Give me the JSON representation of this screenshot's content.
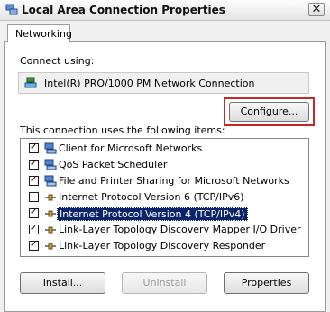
{
  "window": {
    "title": "Local Area Connection Properties",
    "close_glyph": "✕",
    "title_icon": "network-adapter-icon"
  },
  "tabs": [
    {
      "label": "Networking",
      "selected": true
    }
  ],
  "connect_using": {
    "label": "Connect using:",
    "adapter": "Intel(R) PRO/1000 PM Network Connection",
    "adapter_icon": "network-adapter-icon"
  },
  "configure_button": {
    "label": "Configure...",
    "highlighted": true,
    "highlight_color": "#c62828"
  },
  "items_label": "This connection uses the following items:",
  "items": [
    {
      "label": "Client for Microsoft Networks",
      "checked": true,
      "icon": "network-client-icon",
      "selected": false
    },
    {
      "label": "QoS Packet Scheduler",
      "checked": true,
      "icon": "network-client-icon",
      "selected": false
    },
    {
      "label": "File and Printer Sharing for Microsoft Networks",
      "checked": true,
      "icon": "network-client-icon",
      "selected": false
    },
    {
      "label": "Internet Protocol Version 6 (TCP/IPv6)",
      "checked": false,
      "icon": "protocol-icon",
      "selected": false
    },
    {
      "label": "Internet Protocol Version 4 (TCP/IPv4)",
      "checked": true,
      "icon": "protocol-icon",
      "selected": true
    },
    {
      "label": "Link-Layer Topology Discovery Mapper I/O Driver",
      "checked": true,
      "icon": "protocol-icon",
      "selected": false
    },
    {
      "label": "Link-Layer Topology Discovery Responder",
      "checked": true,
      "icon": "protocol-icon",
      "selected": false
    }
  ],
  "buttons": {
    "install": "Install...",
    "uninstall": "Uninstall",
    "properties": "Properties"
  },
  "colors": {
    "selection": "#0a246a",
    "dialog_bg": "#f0f0f0"
  }
}
